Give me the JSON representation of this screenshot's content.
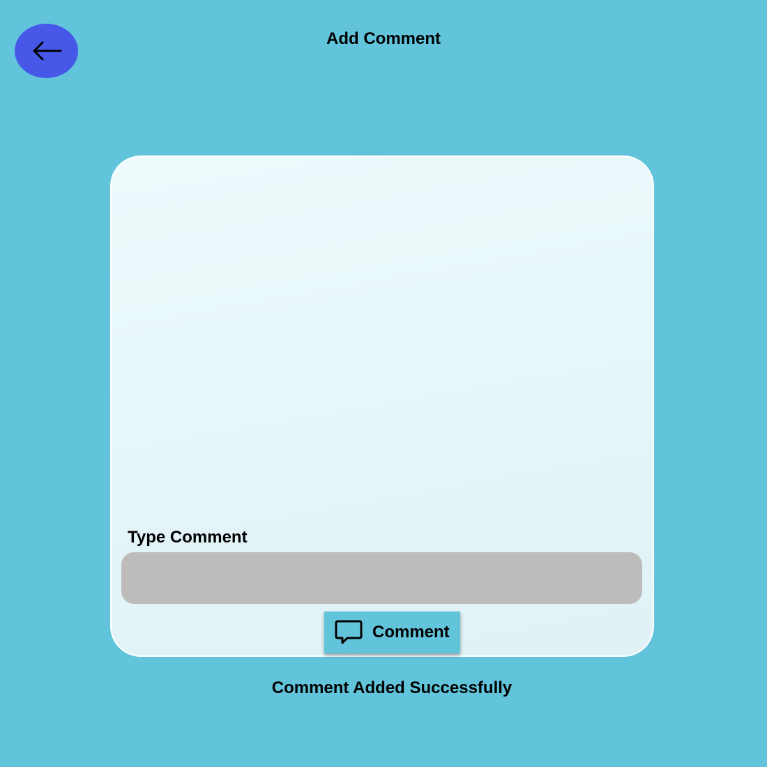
{
  "header": {
    "title": "Add Comment",
    "back_icon": "arrow-left-icon"
  },
  "form": {
    "label": "Type Comment",
    "input_value": "",
    "input_placeholder": "",
    "submit_label": "Comment",
    "submit_icon": "chat-bubble-icon"
  },
  "status": {
    "message": "Comment Added Successfully"
  },
  "colors": {
    "background": "#62c4db",
    "back_button": "#4757e8",
    "input_background": "#bebbbb",
    "card_background": "#e6f6f9"
  }
}
